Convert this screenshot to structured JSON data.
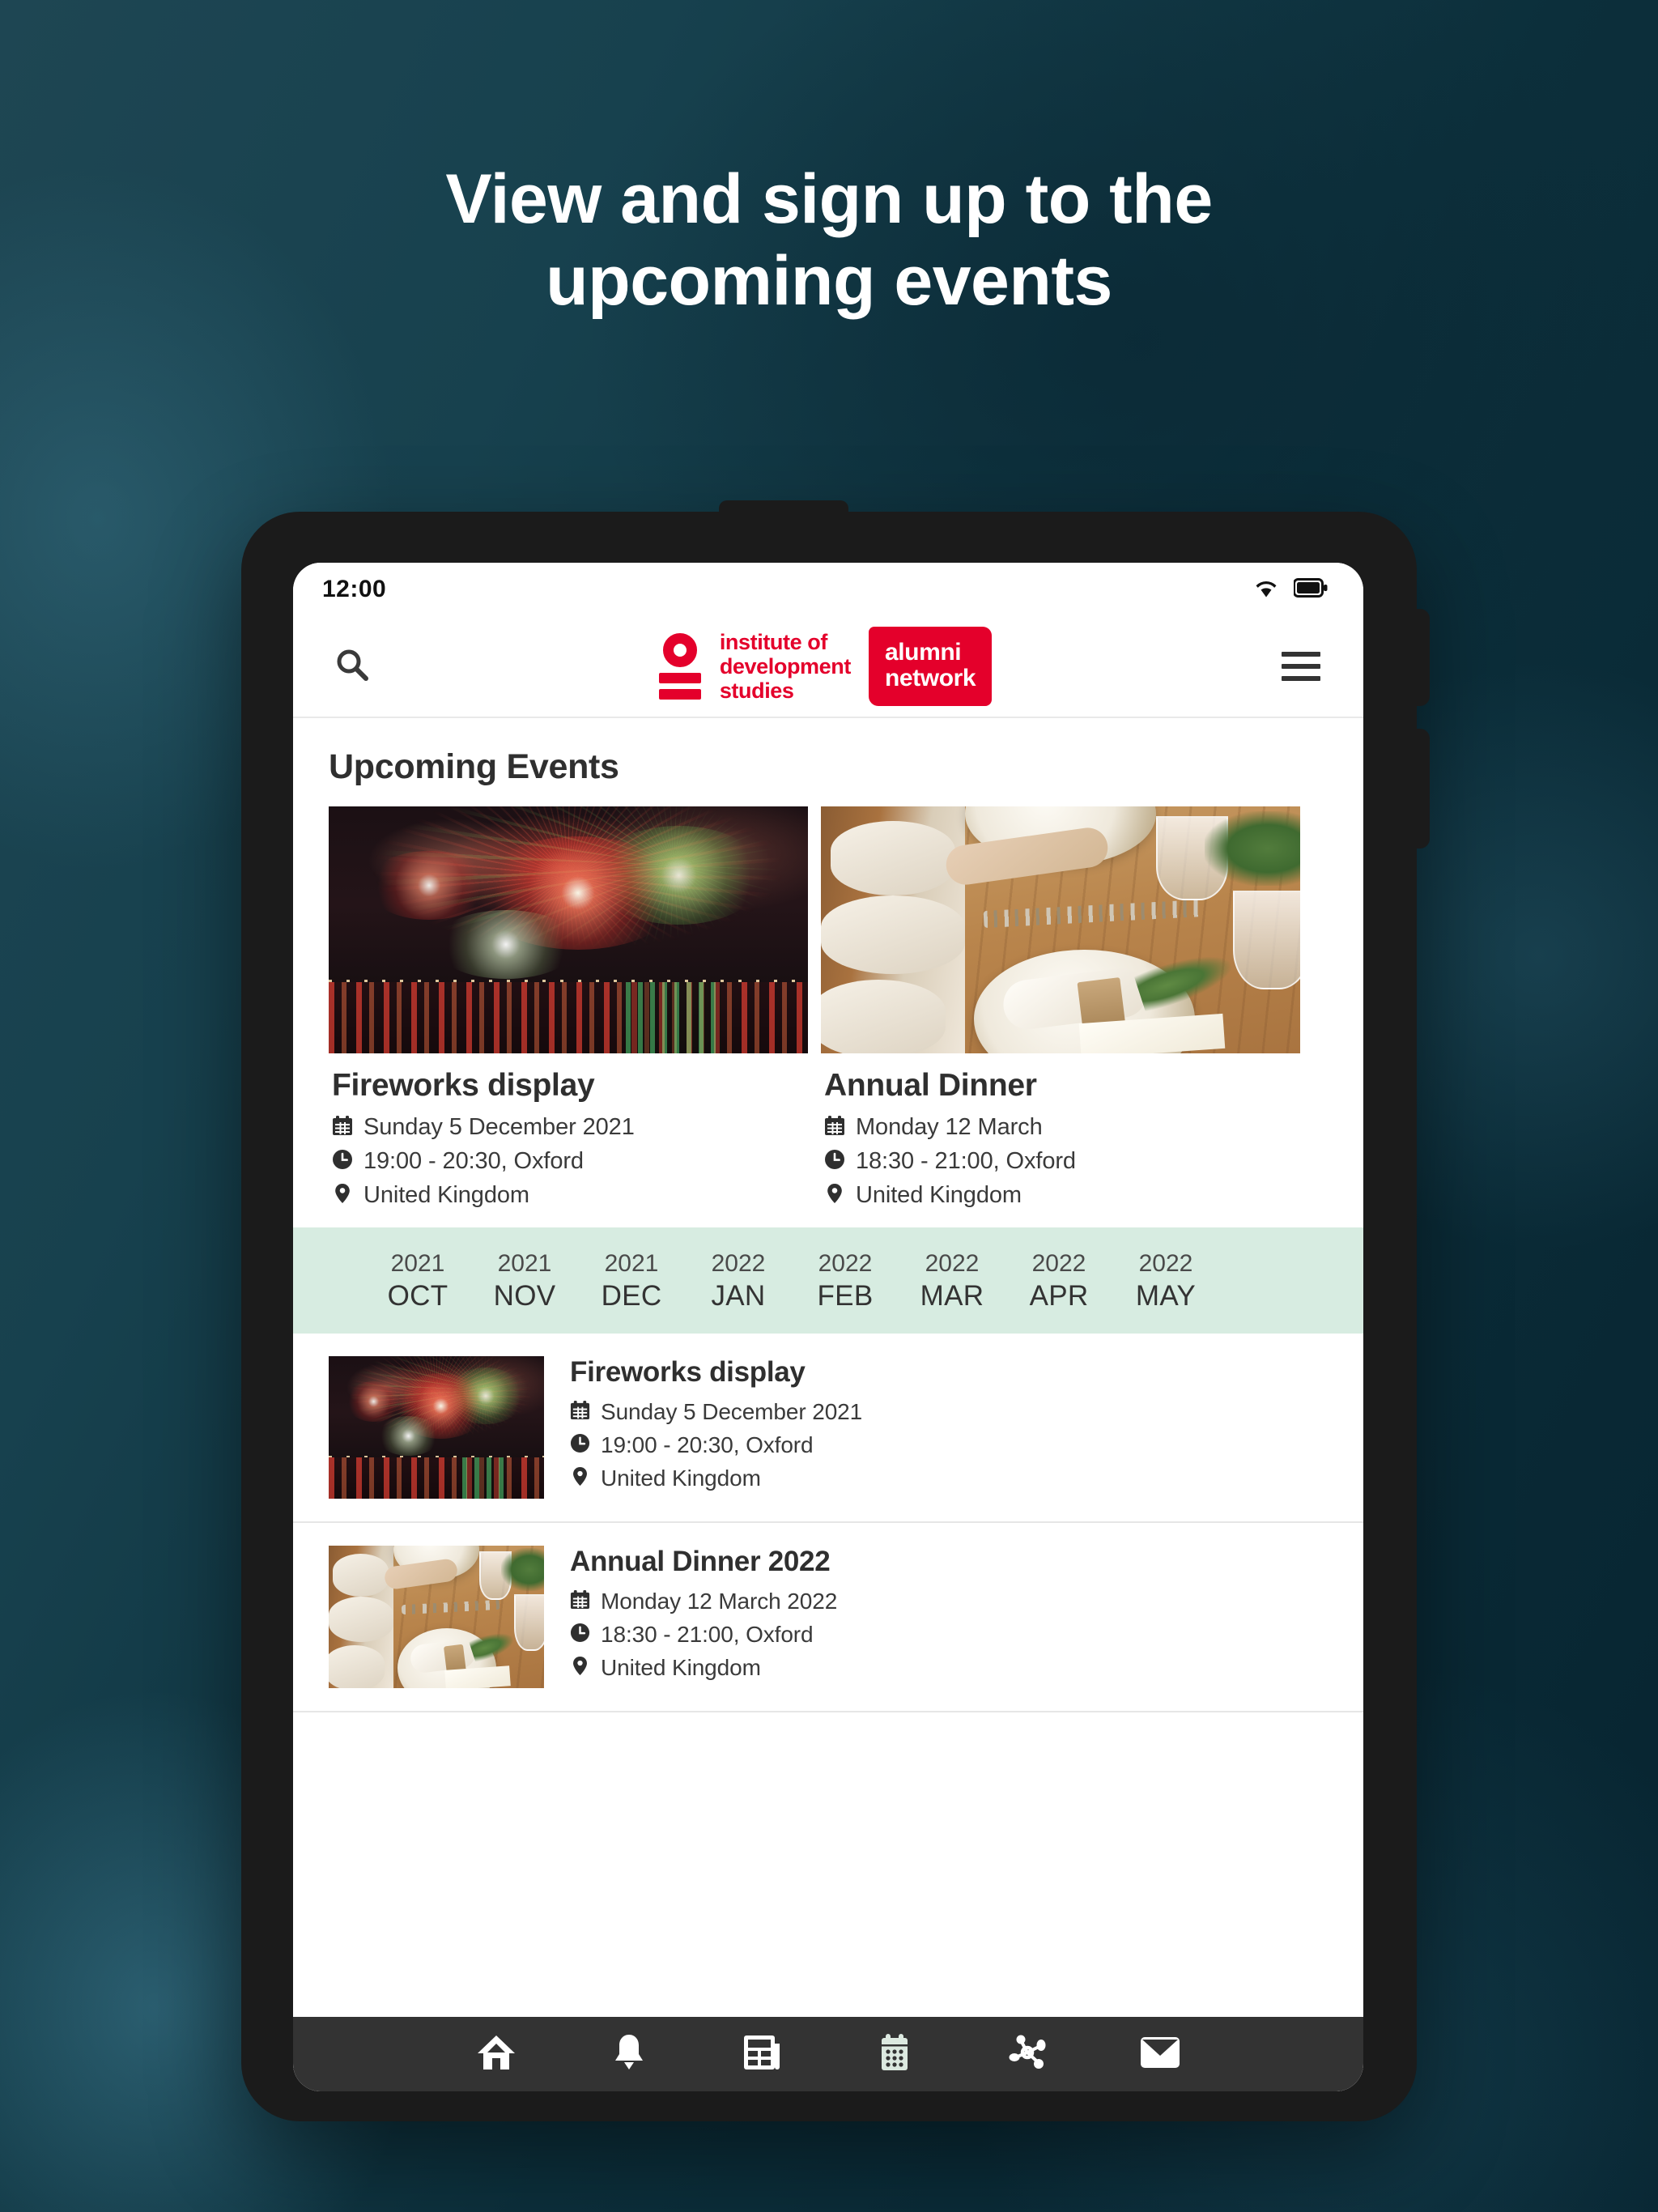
{
  "promo": {
    "headline_line1": "View and sign up to the",
    "headline_line2": "upcoming events"
  },
  "status_bar": {
    "time": "12:00",
    "wifi_icon": "wifi-icon",
    "battery_icon": "battery-icon"
  },
  "app_header": {
    "search_icon": "search-icon",
    "menu_icon": "hamburger-menu-icon",
    "logo": {
      "mark": "ids-logo-mark",
      "line1": "institute of",
      "line2": "development",
      "line3": "studies",
      "badge_line1": "alumni",
      "badge_line2": "network",
      "brand_color": "#e4002b"
    }
  },
  "content": {
    "section_title": "Upcoming Events",
    "featured_events": [
      {
        "image": "fireworks-photo",
        "title": "Fireworks display",
        "date": "Sunday 5 December 2021",
        "time": "19:00 - 20:30, Oxford",
        "location": "United Kingdom"
      },
      {
        "image": "dinner-table-photo",
        "title": "Annual Dinner",
        "date": "Monday 12 March",
        "time": "18:30 - 21:00, Oxford",
        "location": "United Kingdom"
      }
    ],
    "month_strip": {
      "background_color": "#d7ece1",
      "months": [
        {
          "year": "2021",
          "month": "OCT"
        },
        {
          "year": "2021",
          "month": "NOV"
        },
        {
          "year": "2021",
          "month": "DEC"
        },
        {
          "year": "2022",
          "month": "JAN"
        },
        {
          "year": "2022",
          "month": "FEB"
        },
        {
          "year": "2022",
          "month": "MAR"
        },
        {
          "year": "2022",
          "month": "APR"
        },
        {
          "year": "2022",
          "month": "MAY"
        }
      ]
    },
    "event_list": [
      {
        "image": "fireworks-photo",
        "title": "Fireworks display",
        "date": "Sunday 5 December 2021",
        "time": "19:00 - 20:30, Oxford",
        "location": "United Kingdom"
      },
      {
        "image": "dinner-table-photo",
        "title": "Annual Dinner 2022",
        "date": "Monday 12 March 2022",
        "time": "18:30 - 21:00, Oxford",
        "location": "United Kingdom"
      }
    ]
  },
  "bottom_nav": {
    "background_color": "#333333",
    "active_color": "#dce9e0",
    "items": [
      {
        "icon": "home-icon",
        "active": false
      },
      {
        "icon": "bell-icon",
        "active": false
      },
      {
        "icon": "news-feed-icon",
        "active": false
      },
      {
        "icon": "calendar-icon",
        "active": true
      },
      {
        "icon": "network-share-icon",
        "active": false
      },
      {
        "icon": "envelope-icon",
        "active": false
      }
    ]
  }
}
